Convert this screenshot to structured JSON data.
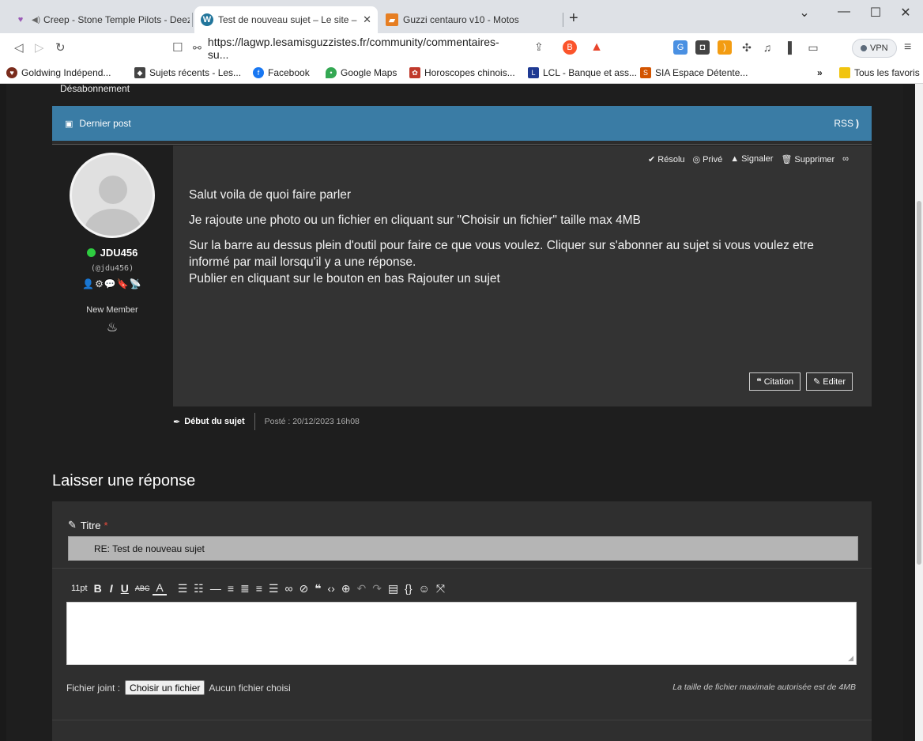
{
  "browser": {
    "tabs": [
      {
        "label": "Creep - Stone Temple Pilots - Deez",
        "icon": "heart-icon"
      },
      {
        "label": "Test de nouveau sujet – Le site –",
        "icon": "wordpress-icon"
      },
      {
        "label": "Guzzi centauro v10 - Motos",
        "icon": "moto-icon"
      }
    ],
    "new_tab": "+",
    "controls": {
      "minimize": "—",
      "maximize": "☐",
      "close": "✕",
      "dropdown": "⌄"
    },
    "url": "https://lagwp.lesamisguzzistes.fr/community/commentaires-su...",
    "vpn_label": "VPN",
    "bookmarks": [
      {
        "label": "Goldwing Indépend...",
        "color": "#7a2c1c"
      },
      {
        "label": "Sujets récents - Les...",
        "color": "#444444"
      },
      {
        "label": "Facebook",
        "color": "#1877f2"
      },
      {
        "label": "Google Maps",
        "color": "#34a853"
      },
      {
        "label": "Horoscopes chinois...",
        "color": "#c0392b"
      },
      {
        "label": "LCL - Banque et ass...",
        "color": "#1f3a93"
      },
      {
        "label": "SIA Espace Détente...",
        "color": "#d35400"
      }
    ],
    "bookmarks_more": "»",
    "all_bookmarks": "Tous les favoris"
  },
  "page": {
    "unsubscribe": "Désabonnement",
    "post_header": {
      "title": "Dernier post",
      "rss": "RSS"
    },
    "author": {
      "name": "JDU456",
      "handle": "(@jdu456)",
      "icons": "👤⚙💬🔖📡",
      "role": "New Member",
      "rank_icon": "♨"
    },
    "actions": [
      {
        "icon": "check-circle-icon",
        "glyph": "✔",
        "label": "Résolu"
      },
      {
        "icon": "eye-slash-icon",
        "glyph": "◎",
        "label": "Privé"
      },
      {
        "icon": "warning-icon",
        "glyph": "▲",
        "label": "Signaler"
      },
      {
        "icon": "trash-icon",
        "glyph": "🗑",
        "label": "Supprimer"
      },
      {
        "icon": "link-icon",
        "glyph": "∞",
        "label": ""
      }
    ],
    "post_text": {
      "p1": "Salut voila de quoi faire parler",
      "p2": "Je rajoute une photo ou un fichier en cliquant sur \"Choisir un fichier\" taille max 4MB",
      "p3a": "Sur la barre au dessus plein d'outil pour faire ce que vous voulez. Cliquer sur s'abonner au sujet si vous voulez etre informé par mail lorsqu'il y a une réponse.",
      "p3b": "Publier en cliquant sur le bouton en bas Rajouter un sujet"
    },
    "buttons": {
      "quote": "Citation",
      "edit": "Editer"
    },
    "meta": {
      "first": "Début du sujet",
      "posted": "Posté : 20/12/2023 16h08"
    },
    "reply": {
      "heading": "Laisser une réponse",
      "title_label": "Titre",
      "required_mark": "*",
      "title_value": "RE: Test de nouveau sujet",
      "font_size": "11pt",
      "attach_label": "Fichier joint :",
      "file_button": "Choisir un fichier",
      "no_file": "Aucun fichier choisi",
      "max_size_note": "La taille de fichier maximale autorisée est de 4MB"
    }
  },
  "colors": {
    "header_blue": "#3a7ca5",
    "post_bg": "#333333",
    "online": "#2ecc40",
    "required": "#e74c3c"
  }
}
